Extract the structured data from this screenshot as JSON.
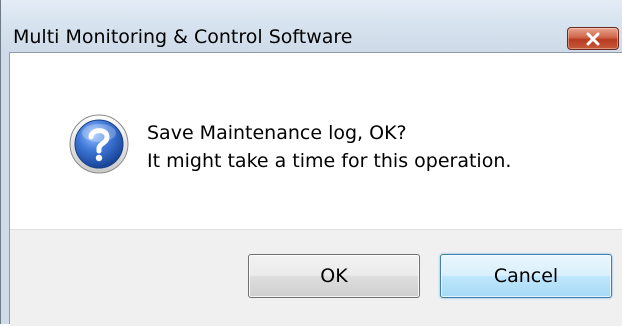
{
  "window": {
    "title": "Multi Monitoring & Control Software",
    "close_icon": "close-x-icon"
  },
  "dialog": {
    "icon": "question-icon",
    "message_line1": "Save Maintenance log, OK?",
    "message_line2": "It might take a time for this operation."
  },
  "buttons": {
    "ok_label": "OK",
    "cancel_label": "Cancel"
  },
  "colors": {
    "close_button": "#c95a3a",
    "question_icon": "#2d63c8",
    "cancel_focus_border": "#3c7fb1"
  }
}
